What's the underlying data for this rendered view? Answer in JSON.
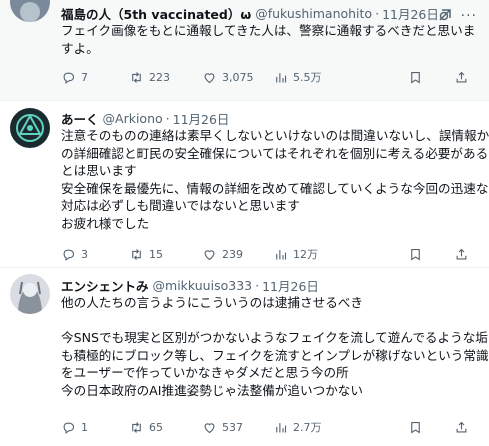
{
  "tweets": [
    {
      "name": "福島の人（5th vaccinated）ω",
      "handle": "@fukushimanohito",
      "date": "11月26日",
      "lines": [
        "フェイク画像をもとに通報してきた人は、警察に通報するべきだと思いますよ。"
      ],
      "replies": "7",
      "retweets": "223",
      "likes": "3,075",
      "views": "5.5万"
    },
    {
      "name": "あーく",
      "handle": "@Arkiono",
      "date": "11月26日",
      "lines": [
        "注意そのものの連絡は素早くしないといけないのは間違いないし、誤情報か",
        "の詳細確認と町民の安全確保についてはそれぞれを個別に考える必要がある",
        "とは思います",
        "安全確保を最優先に、情報の詳細を改めて確認していくような今回の迅速な",
        "対応は必ずしも間違いではないと思います",
        "お疲れ様でした"
      ],
      "replies": "3",
      "retweets": "15",
      "likes": "239",
      "views": "12万"
    },
    {
      "name": "エンシェントみ",
      "handle": "@mikkuuiso333",
      "date": "11月26日",
      "lines": [
        "他の人たちの言うようにこういうのは逮捕させるべき",
        "",
        "今SNSでも現実と区別がつかないようなフェイクを流して遊んでるような垢",
        "も積極的にブロック等し、フェイクを流すとインプレが稼げないという常識",
        "をユーザーで作っていかなきゃダメだと思う今の所",
        "今の日本政府のAI推進姿勢じゃ法整備が追いつかない"
      ],
      "replies": "1",
      "retweets": "65",
      "likes": "537",
      "views": "2.7万"
    }
  ],
  "colors": {
    "text": "#0f1419",
    "muted": "#536471",
    "border": "#eff3f4",
    "hover_bg": "#f7f9f9"
  }
}
